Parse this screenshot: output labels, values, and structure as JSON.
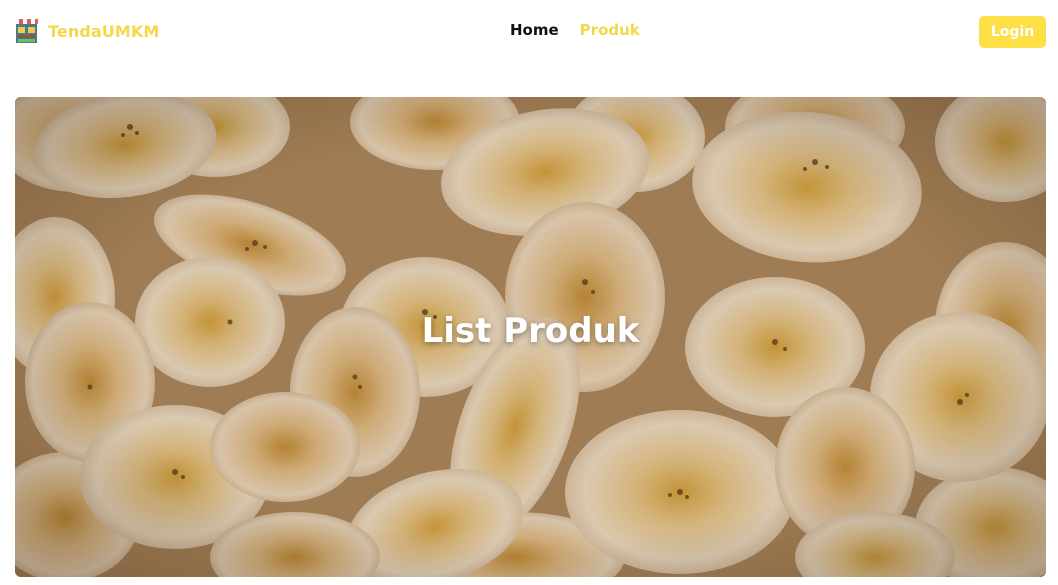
{
  "navbar": {
    "brand": {
      "name": "TendaUMKM",
      "icon": "market-stall-icon"
    },
    "links": [
      {
        "label": "Home",
        "active": false
      },
      {
        "label": "Produk",
        "active": true
      }
    ],
    "login_label": "Login"
  },
  "hero": {
    "title": "List Produk",
    "image": "banana-chips-photo"
  },
  "colors": {
    "accent": "#f5d84a",
    "button": "#fde047",
    "nav_text": "#111111"
  }
}
